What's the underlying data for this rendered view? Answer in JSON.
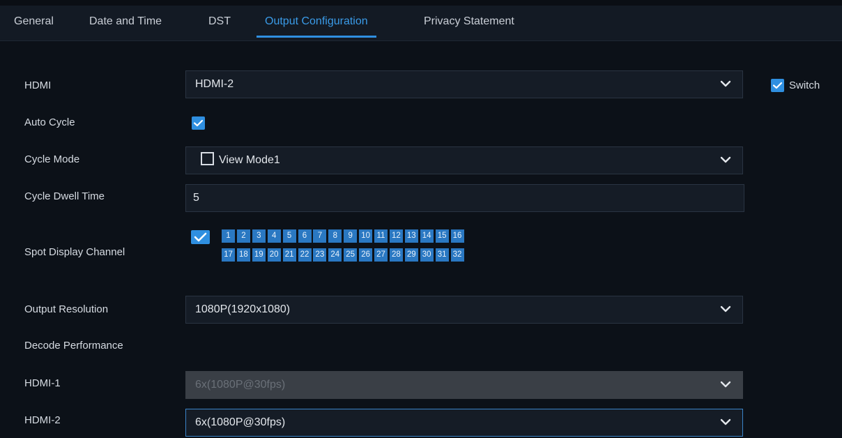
{
  "tabs": [
    {
      "label": "General"
    },
    {
      "label": "Date and Time"
    },
    {
      "label": "DST"
    },
    {
      "label": "Output Configuration",
      "active": true
    },
    {
      "label": "Privacy Statement"
    }
  ],
  "form": {
    "hdmi": {
      "label": "HDMI",
      "value": "HDMI-2"
    },
    "switch": {
      "label": "Switch",
      "checked": true
    },
    "auto_cycle": {
      "label": "Auto Cycle",
      "checked": true
    },
    "cycle_mode": {
      "label": "Cycle Mode",
      "value": "View Mode1"
    },
    "cycle_dwell_time": {
      "label": "Cycle Dwell Time",
      "value": "5"
    },
    "spot_display_channel": {
      "label": "Spot Display Channel",
      "all_checked": true,
      "row1": [
        "1",
        "2",
        "3",
        "4",
        "5",
        "6",
        "7",
        "8",
        "9",
        "10",
        "11",
        "12",
        "13",
        "14",
        "15",
        "16"
      ],
      "row2": [
        "17",
        "18",
        "19",
        "20",
        "21",
        "22",
        "23",
        "24",
        "25",
        "26",
        "27",
        "28",
        "29",
        "30",
        "31",
        "32"
      ]
    },
    "output_resolution": {
      "label": "Output Resolution",
      "value": "1080P(1920x1080)"
    },
    "decode_performance": {
      "label": "Decode Performance"
    },
    "hdmi1": {
      "label": "HDMI-1",
      "value": "6x(1080P@30fps)",
      "disabled": true
    },
    "hdmi2": {
      "label": "HDMI-2",
      "value": "6x(1080P@30fps)"
    }
  },
  "colors": {
    "accent": "#2f8fe0",
    "channel_bg": "#2a78c2",
    "background": "#0c1118",
    "field_bg": "#151c26",
    "disabled_bg": "#3a3f46"
  },
  "icons": {
    "dropdown": "chevron-down-icon",
    "checkbox": "checkmark-icon"
  }
}
